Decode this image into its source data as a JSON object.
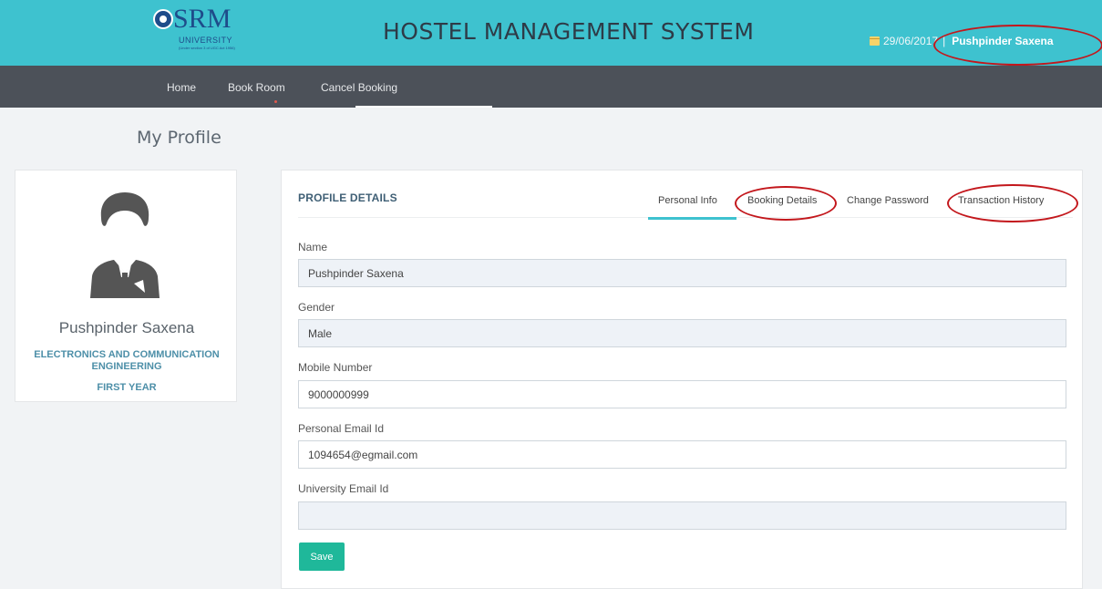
{
  "header": {
    "logo_text": "SRM",
    "logo_subtext": "UNIVERSITY",
    "logo_tagline": "(Under section 3 of UGC Act 1956)",
    "title": "HOSTEL MANAGEMENT SYSTEM",
    "date": "29/06/2017",
    "separator": "|",
    "user_name": "Pushpinder Saxena"
  },
  "nav": {
    "items": [
      "Home",
      "Book Room",
      "Cancel Booking"
    ]
  },
  "page_title": "My Profile",
  "profile_card": {
    "name": "Pushpinder Saxena",
    "department": "ELECTRONICS AND COMMUNICATION ENGINEERING",
    "year": "FIRST YEAR"
  },
  "details": {
    "section_title": "PROFILE DETAILS",
    "tabs": [
      "Personal Info",
      "Booking Details",
      "Change Password",
      "Transaction History"
    ],
    "active_tab": "Personal Info",
    "fields": {
      "name": {
        "label": "Name",
        "value": "Pushpinder Saxena"
      },
      "gender": {
        "label": "Gender",
        "value": "Male"
      },
      "mobile": {
        "label": "Mobile Number",
        "value": "9000000999"
      },
      "personal_email": {
        "label": "Personal Email Id",
        "value": "1094654@egmail.com"
      },
      "university_email": {
        "label": "University Email Id",
        "value": ""
      }
    },
    "save_label": "Save"
  },
  "colors": {
    "header_bg": "#3ec2cf",
    "nav_bg": "#4c5159",
    "accent": "#3ec2cf",
    "save_button": "#1fb89a",
    "annotation_red": "#c3171c"
  }
}
